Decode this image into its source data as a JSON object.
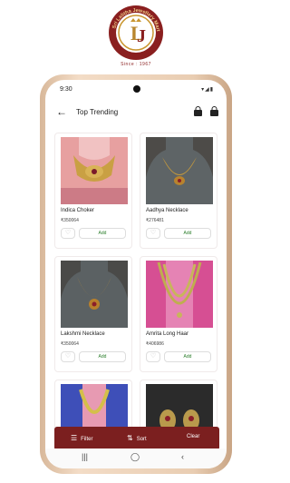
{
  "brand": {
    "name": "Sri Lalitha Jewellery Mart",
    "since": "Since : 1967"
  },
  "status": {
    "time": "9:30"
  },
  "appbar": {
    "title": "Top Trending"
  },
  "products": [
    {
      "name": "Indica Choker",
      "price": "₹350064",
      "add_label": "Add"
    },
    {
      "name": "Aadhya Necklace",
      "price": "₹276481",
      "add_label": "Add"
    },
    {
      "name": "Lakshmi Necklace",
      "price": "₹350064",
      "add_label": "Add"
    },
    {
      "name": "Amrita Long Haar",
      "price": "₹406986",
      "add_label": "Add"
    }
  ],
  "bottombar": {
    "filter_label": "Filter",
    "sort_label": "Sort",
    "clear_label": "Clear"
  },
  "colors": {
    "brand": "#7b1f1f",
    "add_text": "#2a7d2a"
  }
}
